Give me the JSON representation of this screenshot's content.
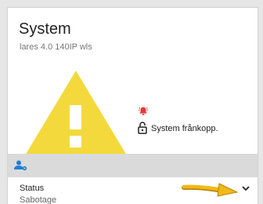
{
  "card": {
    "title": "System",
    "subtitle": "lares 4.0 140IP wls"
  },
  "alert": {
    "icon": "warning-triangle-icon",
    "bell_icon": "alarm-bell-icon",
    "lock_icon": "unlocked-padlock-icon",
    "message": "System frånkopp."
  },
  "section": {
    "icon": "user-settings-icon"
  },
  "status": {
    "label": "Status",
    "value": "Sabotage",
    "expand_icon": "chevron-down-icon"
  },
  "colors": {
    "warning": "#f4d93c",
    "alarm": "#e53935",
    "accent": "#1e7fd6",
    "annotation_arrow": "#f2b817"
  }
}
